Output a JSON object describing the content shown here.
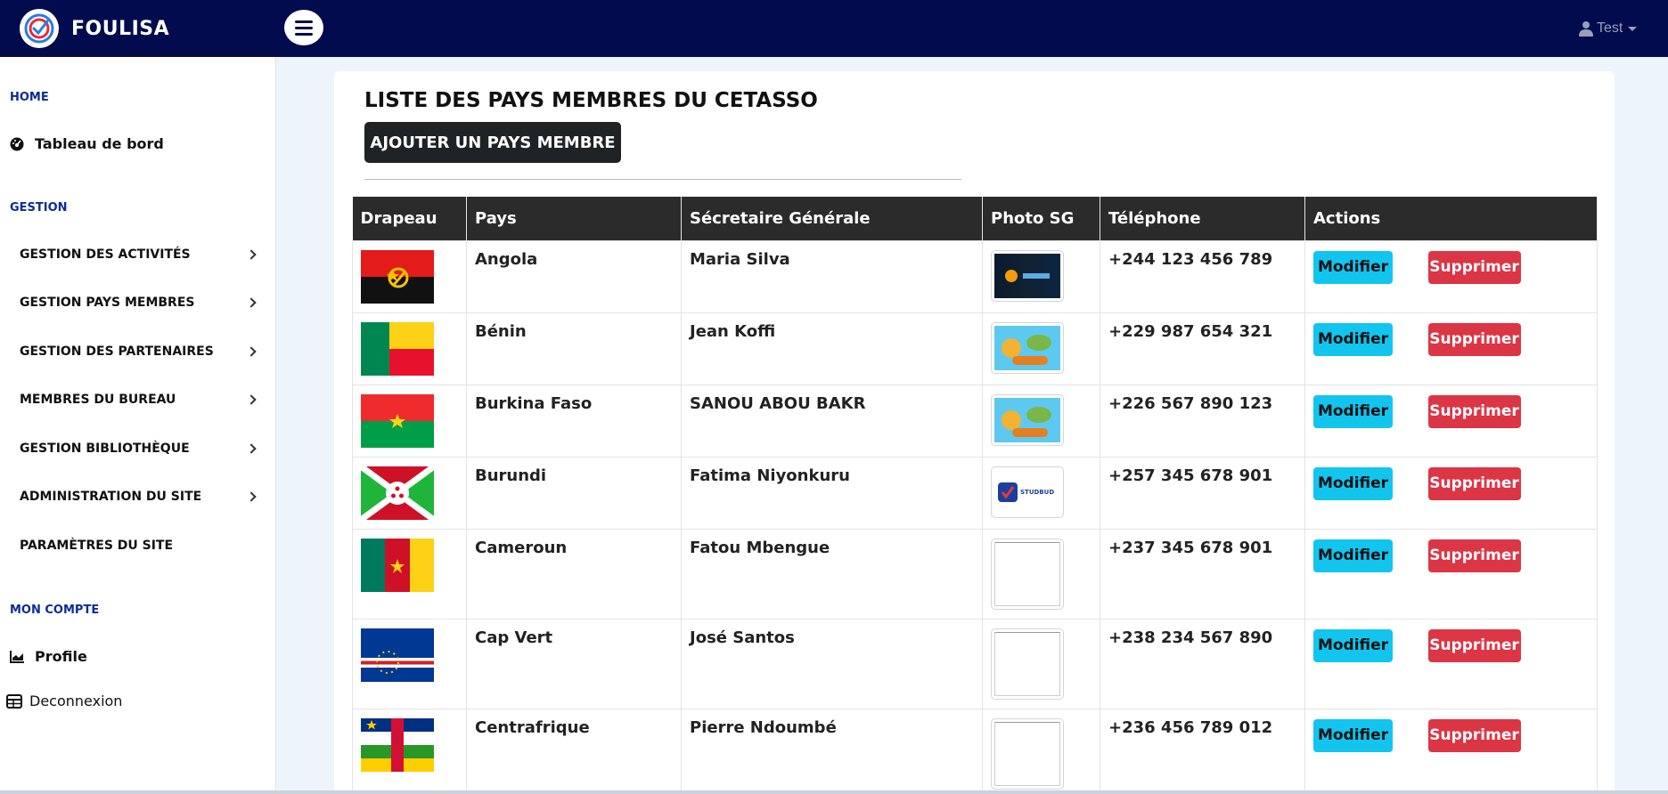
{
  "app": {
    "name": "FOULISA",
    "colors": {
      "topbar": "#020b4e",
      "heading_blue": "#0d2b9d",
      "modify": "#11c5ef",
      "delete": "#dc3545"
    }
  },
  "header": {
    "user_label": "Test"
  },
  "sidebar": {
    "home_heading": "HOME",
    "dashboard": "Tableau de bord",
    "gestion_heading": "GESTION",
    "items": [
      {
        "label": "GESTION DES ACTIVITÉS",
        "has_chevron": true
      },
      {
        "label": "GESTION PAYS MEMBRES",
        "has_chevron": true
      },
      {
        "label": "GESTION DES PARTENAIRES",
        "has_chevron": true
      },
      {
        "label": "MEMBRES DU BUREAU",
        "has_chevron": true
      },
      {
        "label": "GESTION BIBLIOTHÈQUE",
        "has_chevron": true
      },
      {
        "label": "ADMINISTRATION DU SITE",
        "has_chevron": true
      },
      {
        "label": "PARAMÈTRES DU SITE",
        "has_chevron": false
      }
    ],
    "account_heading": "MON COMPTE",
    "profile": "Profile",
    "logout": "Deconnexion"
  },
  "main": {
    "title": "LISTE DES PAYS MEMBRES DU CETASSO",
    "add_button": "AJOUTER UN PAYS MEMBRE",
    "columns": [
      "Drapeau",
      "Pays",
      "Sécretaire Générale",
      "Photo SG",
      "Téléphone",
      "Actions"
    ],
    "modify_label": "Modifier",
    "delete_label": "Supprimer",
    "rows": [
      {
        "flag": "angola",
        "pays": "Angola",
        "sg": "Maria Silva",
        "photo": "dark-banner",
        "tel": "+244 123 456 789"
      },
      {
        "flag": "benin",
        "pays": "Bénin",
        "sg": "Jean Koffi",
        "photo": "cartoon",
        "tel": "+229 987 654 321"
      },
      {
        "flag": "burkina",
        "pays": "Burkina Faso",
        "sg": "SANOU ABOU BAKR",
        "photo": "cartoon",
        "tel": "+226 567 890 123"
      },
      {
        "flag": "burundi",
        "pays": "Burundi",
        "sg": "Fatima Niyonkuru",
        "photo": "studbud-logo",
        "tel": "+257 345 678 901"
      },
      {
        "flag": "cameroun",
        "pays": "Cameroun",
        "sg": "Fatou Mbengue",
        "photo": "broken",
        "tel": "+237 345 678 901"
      },
      {
        "flag": "capvert",
        "pays": "Cap Vert",
        "sg": "José Santos",
        "photo": "broken",
        "tel": "+238 234 567 890"
      },
      {
        "flag": "centrafrique",
        "pays": "Centrafrique",
        "sg": "Pierre Ndoumbé",
        "photo": "broken",
        "tel": "+236 456 789 012"
      }
    ]
  }
}
